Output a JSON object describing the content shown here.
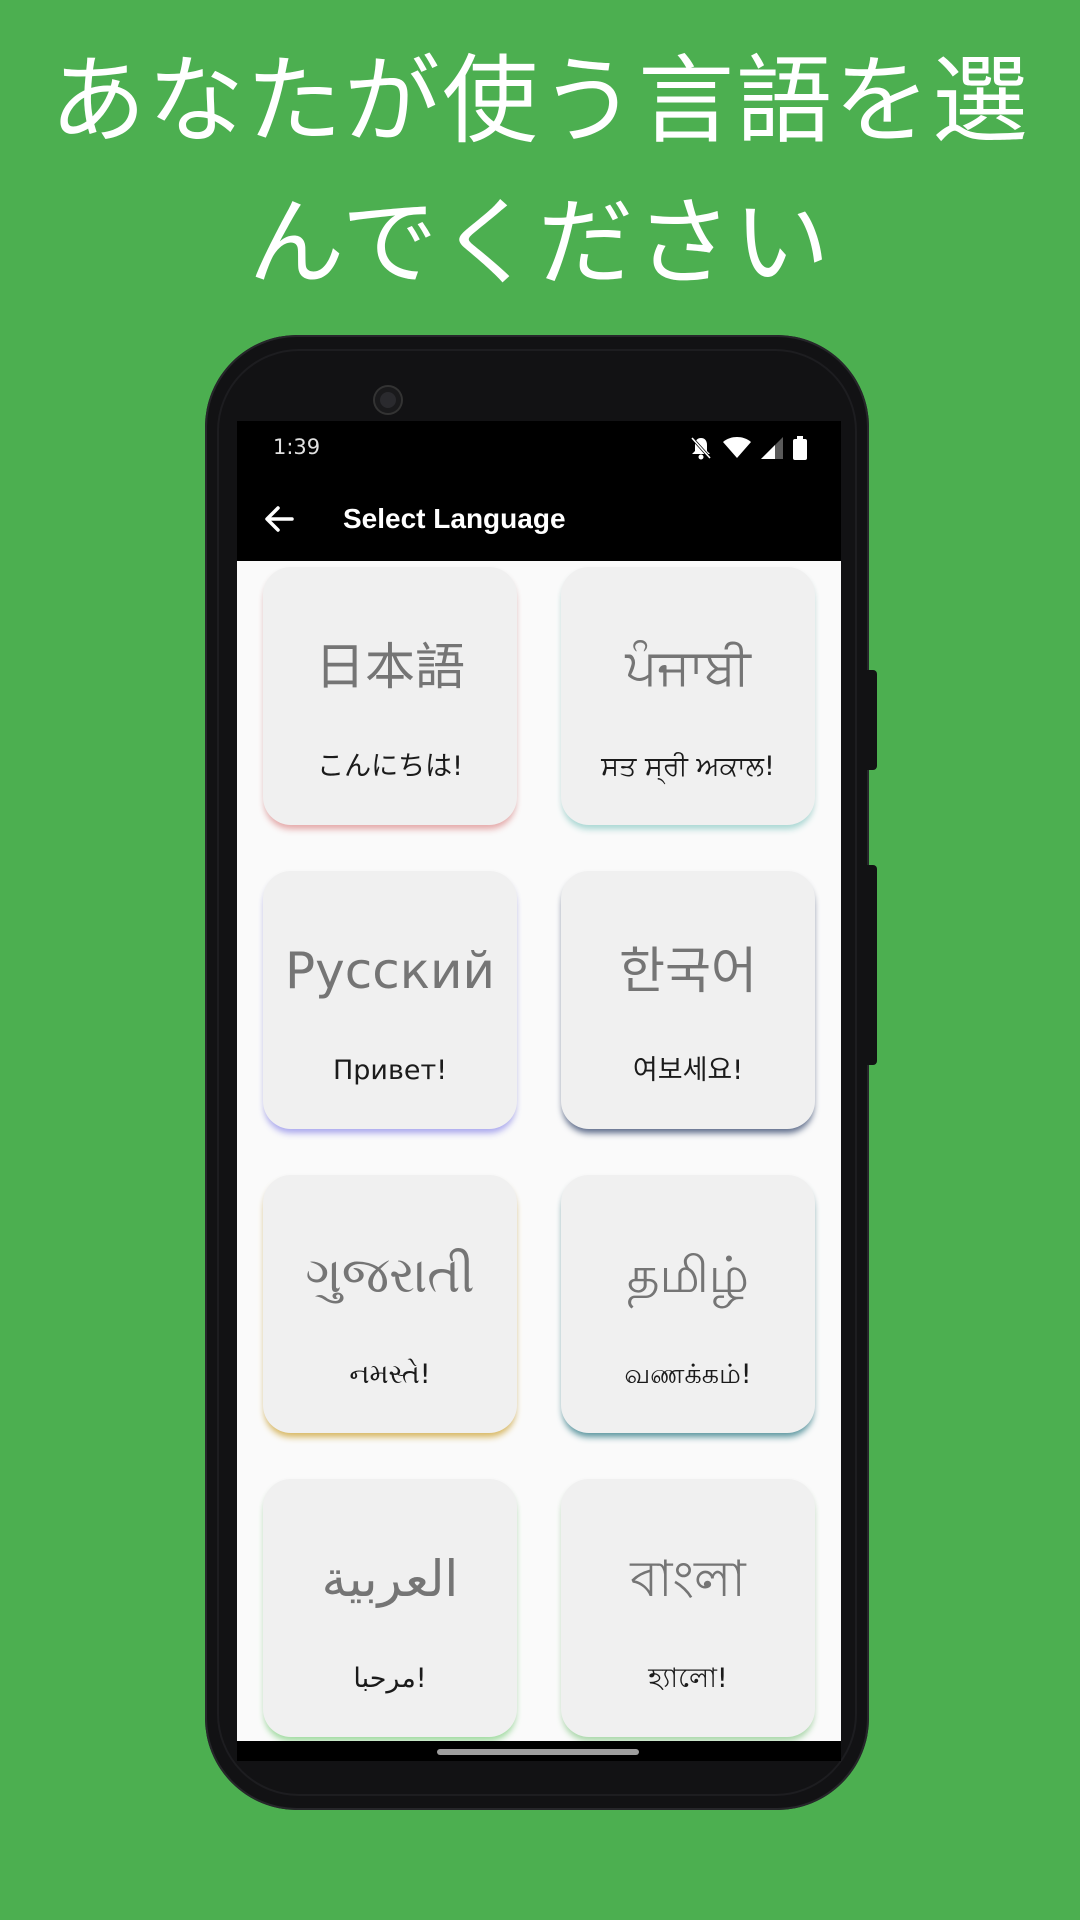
{
  "headline": {
    "line1": "あなたが使う言語を選",
    "line2": "んでください"
  },
  "status_bar": {
    "time": "1:39",
    "icons": [
      "bell-off-icon",
      "wifi-icon",
      "cell-signal-icon",
      "battery-icon"
    ]
  },
  "app_bar": {
    "back_icon": "arrow-left-icon",
    "title": "Select Language"
  },
  "languages": [
    {
      "name": "日本語",
      "greeting": "こんにちは!",
      "accent": "#e6a8a8"
    },
    {
      "name": "ਪੰਜਾਬੀ",
      "greeting": "ਸਤ ਸ੍ਰੀ ਅਕਾਲ!",
      "accent": "#a8d8d4"
    },
    {
      "name": "Русский",
      "greeting": "Привет!",
      "accent": "#aaa8f0"
    },
    {
      "name": "한국어",
      "greeting": "여보세요!",
      "accent": "#5c6b8a"
    },
    {
      "name": "ગુજરાતી",
      "greeting": "નમસ્તે!",
      "accent": "#d9b860"
    },
    {
      "name": "தமிழ்",
      "greeting": "வணக்கம்!",
      "accent": "#5b97a0"
    },
    {
      "name": "العربية",
      "greeting": "مرحبا!",
      "accent": "#9fdc9f"
    },
    {
      "name": "বাংলা",
      "greeting": "হ্যালো!",
      "accent": "#a8d8a8"
    }
  ],
  "colors": {
    "background": "#4caf50",
    "card": "#f0f0f0",
    "app_bar": "#000000"
  }
}
